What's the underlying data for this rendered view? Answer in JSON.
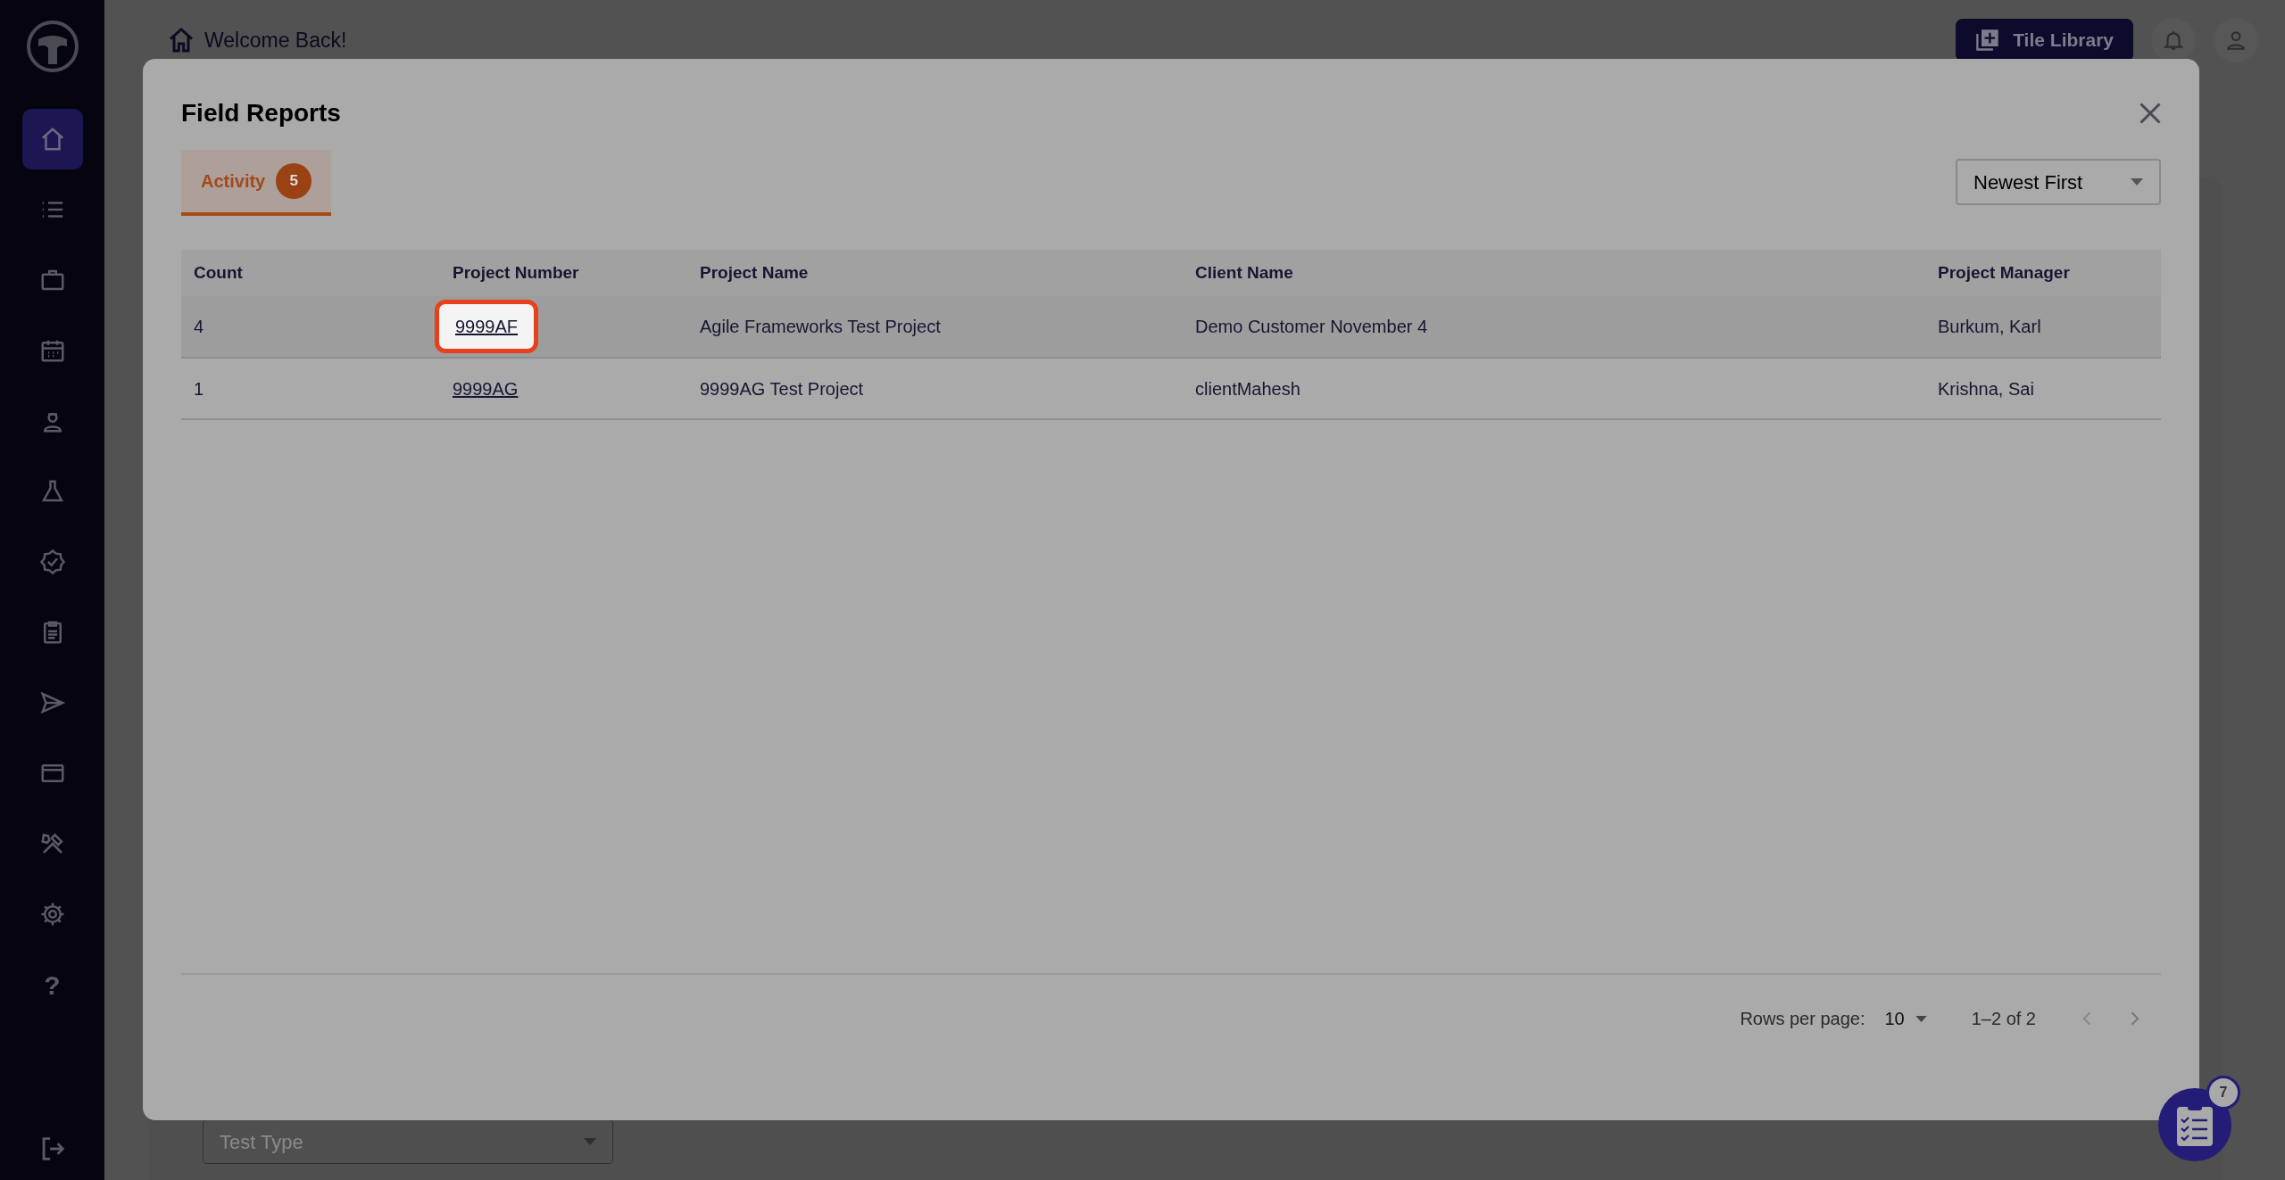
{
  "sidebar": {
    "items": [
      {
        "kind": "home",
        "selected": true
      },
      {
        "kind": "list",
        "selected": false
      },
      {
        "kind": "briefcase",
        "selected": false
      },
      {
        "kind": "calendar",
        "selected": false
      },
      {
        "kind": "worker",
        "selected": false
      },
      {
        "kind": "flask",
        "selected": false
      },
      {
        "kind": "badge",
        "selected": false
      },
      {
        "kind": "clipboard",
        "selected": false
      },
      {
        "kind": "send",
        "selected": false
      },
      {
        "kind": "card",
        "selected": false
      },
      {
        "kind": "tools",
        "selected": false
      },
      {
        "kind": "gear",
        "selected": false
      },
      {
        "kind": "glyph",
        "glyph": "?",
        "selected": false
      }
    ]
  },
  "header": {
    "greeting": "Welcome Back!",
    "tile_library_button": "Tile Library"
  },
  "background": {
    "test_type_select": {
      "placeholder": "Test Type"
    }
  },
  "modal": {
    "title": "Field Reports",
    "tabs": [
      {
        "label": "Activity",
        "badge": "5",
        "selected": true
      }
    ],
    "sort_select": {
      "value": "Newest First"
    },
    "table": {
      "columns": [
        "Count",
        "Project Number",
        "Project Name",
        "Client Name",
        "Project Manager"
      ],
      "rows": [
        {
          "hovered": true,
          "spotlight": true,
          "cells": [
            "4",
            "9999AF",
            "Agile Frameworks Test Project",
            "Demo Customer November 4",
            "Burkum, Karl"
          ]
        },
        {
          "hovered": false,
          "spotlight": false,
          "cells": [
            "1",
            "9999AG",
            "9999AG Test Project",
            "clientMahesh",
            "Krishna, Sai"
          ]
        }
      ]
    },
    "pagination": {
      "rows_per_page_label": "Rows per page:",
      "rows_per_page": "10",
      "range": "1–2 of 2"
    }
  },
  "fab": {
    "badge": "7"
  }
}
